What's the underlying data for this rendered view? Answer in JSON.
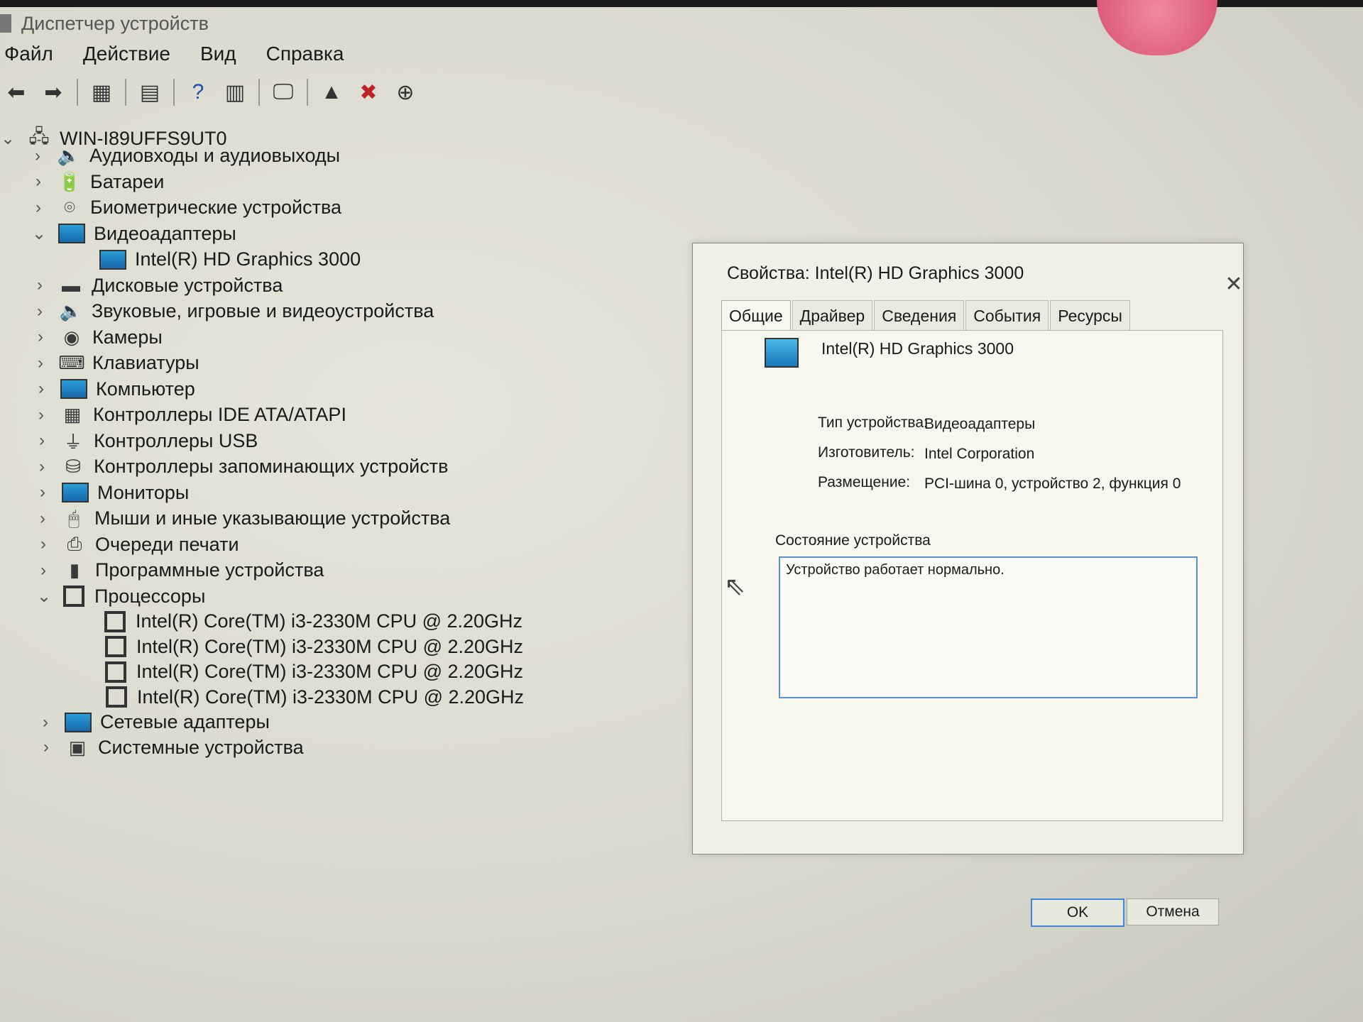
{
  "window": {
    "title": "Диспетчер устройств"
  },
  "menu": [
    "Файл",
    "Действие",
    "Вид",
    "Справка"
  ],
  "toolbar_icons": [
    "back-icon",
    "forward-icon",
    "properties-icon",
    "view-icon",
    "help-icon",
    "console-icon",
    "scan-icon",
    "update-driver-icon",
    "remove-device-icon",
    "download-icon"
  ],
  "tree": {
    "root": "WIN-I89UFFS9UT0",
    "items": [
      {
        "label": "Аудиовходы и аудиовыходы",
        "expanded": false
      },
      {
        "label": "Батареи",
        "expanded": false
      },
      {
        "label": "Биометрические устройства",
        "expanded": false
      },
      {
        "label": "Видеоадаптеры",
        "expanded": true
      },
      {
        "label": "Intel(R) HD Graphics 3000",
        "child": true
      },
      {
        "label": "Дисковые устройства",
        "expanded": false
      },
      {
        "label": "Звуковые, игровые и видеоустройства",
        "expanded": false
      },
      {
        "label": "Камеры",
        "expanded": false
      },
      {
        "label": "Клавиатуры",
        "expanded": false
      },
      {
        "label": "Компьютер",
        "expanded": false
      },
      {
        "label": "Контроллеры IDE ATA/ATAPI",
        "expanded": false
      },
      {
        "label": "Контроллеры USB",
        "expanded": false
      },
      {
        "label": "Контроллеры запоминающих устройств",
        "expanded": false
      },
      {
        "label": "Мониторы",
        "expanded": false
      },
      {
        "label": "Мыши и иные указывающие устройства",
        "expanded": false
      },
      {
        "label": "Очереди печати",
        "expanded": false
      },
      {
        "label": "Программные устройства",
        "expanded": false
      },
      {
        "label": "Процессоры",
        "expanded": true
      },
      {
        "label": "Intel(R) Core(TM) i3-2330M CPU @ 2.20GHz",
        "child": true
      },
      {
        "label": "Intel(R) Core(TM) i3-2330M CPU @ 2.20GHz",
        "child": true
      },
      {
        "label": "Intel(R) Core(TM) i3-2330M CPU @ 2.20GHz",
        "child": true
      },
      {
        "label": "Intel(R) Core(TM) i3-2330M CPU @ 2.20GHz",
        "child": true
      },
      {
        "label": "Сетевые адаптеры",
        "expanded": false
      },
      {
        "label": "Системные устройства",
        "expanded": false
      }
    ]
  },
  "dialog": {
    "title": "Свойства: Intel(R) HD Graphics 3000",
    "tabs": [
      "Общие",
      "Драйвер",
      "Сведения",
      "События",
      "Ресурсы"
    ],
    "active_tab": "Общие",
    "device_name": "Intel(R) HD Graphics 3000",
    "props": [
      {
        "label": "Тип устройства:",
        "value": "Видеоадаптеры"
      },
      {
        "label": "Изготовитель:",
        "value": "Intel Corporation"
      },
      {
        "label": "Размещение:",
        "value": "PCI-шина 0, устройство 2, функция 0"
      }
    ],
    "status_caption": "Состояние устройства",
    "status_text": "Устройство работает нормально.",
    "ok": "OK",
    "cancel": "Отмена"
  }
}
